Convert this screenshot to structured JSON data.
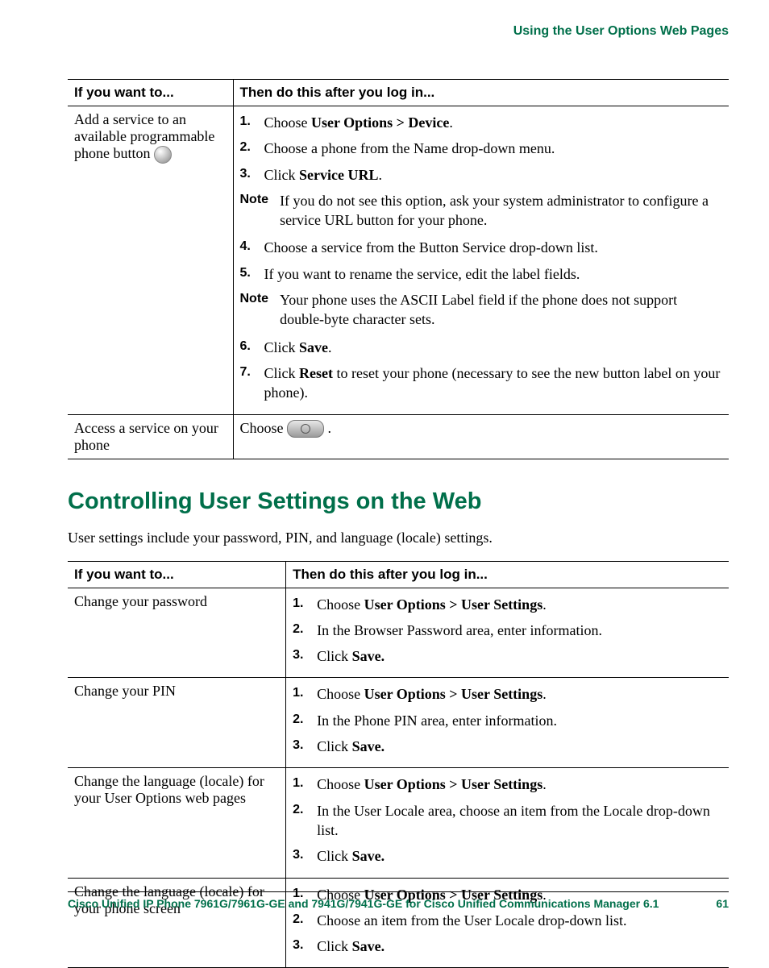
{
  "header": {
    "chapter": "Using the User Options Web Pages"
  },
  "table1": {
    "headers": {
      "left": "If you want to...",
      "right": "Then do this after you log in..."
    },
    "rows": [
      {
        "task": "Add a service to an available programmable phone button",
        "type": "steps_with_notes",
        "items": [
          {
            "kind": "step",
            "num": "1.",
            "pre": "Choose ",
            "bold": "User Options > Device",
            "post": "."
          },
          {
            "kind": "step",
            "num": "2.",
            "text": "Choose a phone from the Name drop-down menu."
          },
          {
            "kind": "step",
            "num": "3.",
            "pre": "Click ",
            "bold": "Service URL",
            "post": "."
          },
          {
            "kind": "note",
            "label": "Note",
            "text": "If you do not see this option, ask your system administrator to configure a service URL button for your phone."
          },
          {
            "kind": "step",
            "num": "4.",
            "text": "Choose a service from the Button Service drop-down list."
          },
          {
            "kind": "step",
            "num": "5.",
            "text": "If you want to rename the service, edit the label fields."
          },
          {
            "kind": "note",
            "label": "Note",
            "text": "Your phone uses the ASCII Label field if the phone does not support double-byte character sets."
          },
          {
            "kind": "step",
            "num": "6.",
            "pre": "Click ",
            "bold": "Save",
            "post": "."
          },
          {
            "kind": "step",
            "num": "7.",
            "pre": "Click ",
            "bold": "Reset",
            "post": " to reset your phone (necessary to see the new button label on your phone)."
          }
        ]
      },
      {
        "task": "Access a service on your phone",
        "type": "plain",
        "pre": "Choose ",
        "post": " ."
      }
    ]
  },
  "section": {
    "heading": "Controlling User Settings on the Web",
    "intro": "User settings include your password, PIN, and language (locale) settings."
  },
  "table2": {
    "headers": {
      "left": "If you want to...",
      "right": "Then do this after you log in..."
    },
    "rows": [
      {
        "task": "Change your password",
        "steps": [
          {
            "num": "1.",
            "pre": "Choose ",
            "bold": "User Options > User Settings",
            "post": "."
          },
          {
            "num": "2.",
            "text": "In the Browser Password area, enter information."
          },
          {
            "num": "3.",
            "pre": "Click ",
            "bold": "Save.",
            "post": ""
          }
        ]
      },
      {
        "task": "Change your PIN",
        "steps": [
          {
            "num": "1.",
            "pre": "Choose ",
            "bold": "User Options > User Settings",
            "post": "."
          },
          {
            "num": "2.",
            "text": "In the Phone PIN area, enter information."
          },
          {
            "num": "3.",
            "pre": "Click ",
            "bold": "Save.",
            "post": ""
          }
        ]
      },
      {
        "task": "Change the language (locale) for your User Options web pages",
        "steps": [
          {
            "num": "1.",
            "pre": "Choose ",
            "bold": "User Options > User Settings",
            "post": "."
          },
          {
            "num": "2.",
            "text": "In the User Locale area, choose an item from the Locale drop-down list."
          },
          {
            "num": "3.",
            "pre": "Click ",
            "bold": "Save.",
            "post": ""
          }
        ]
      },
      {
        "task": "Change the language (locale) for your phone screen",
        "steps": [
          {
            "num": "1.",
            "pre": "Choose ",
            "bold": "User Options > User Settings",
            "post": "."
          },
          {
            "num": "2.",
            "text": "Choose an item from the User Locale drop-down list."
          },
          {
            "num": "3.",
            "pre": "Click ",
            "bold": "Save.",
            "post": ""
          }
        ]
      }
    ]
  },
  "footer": {
    "title": "Cisco Unified IP Phone 7961G/7961G-GE and 7941G/7941G-GE for Cisco Unified Communications Manager 6.1",
    "page": "61"
  }
}
